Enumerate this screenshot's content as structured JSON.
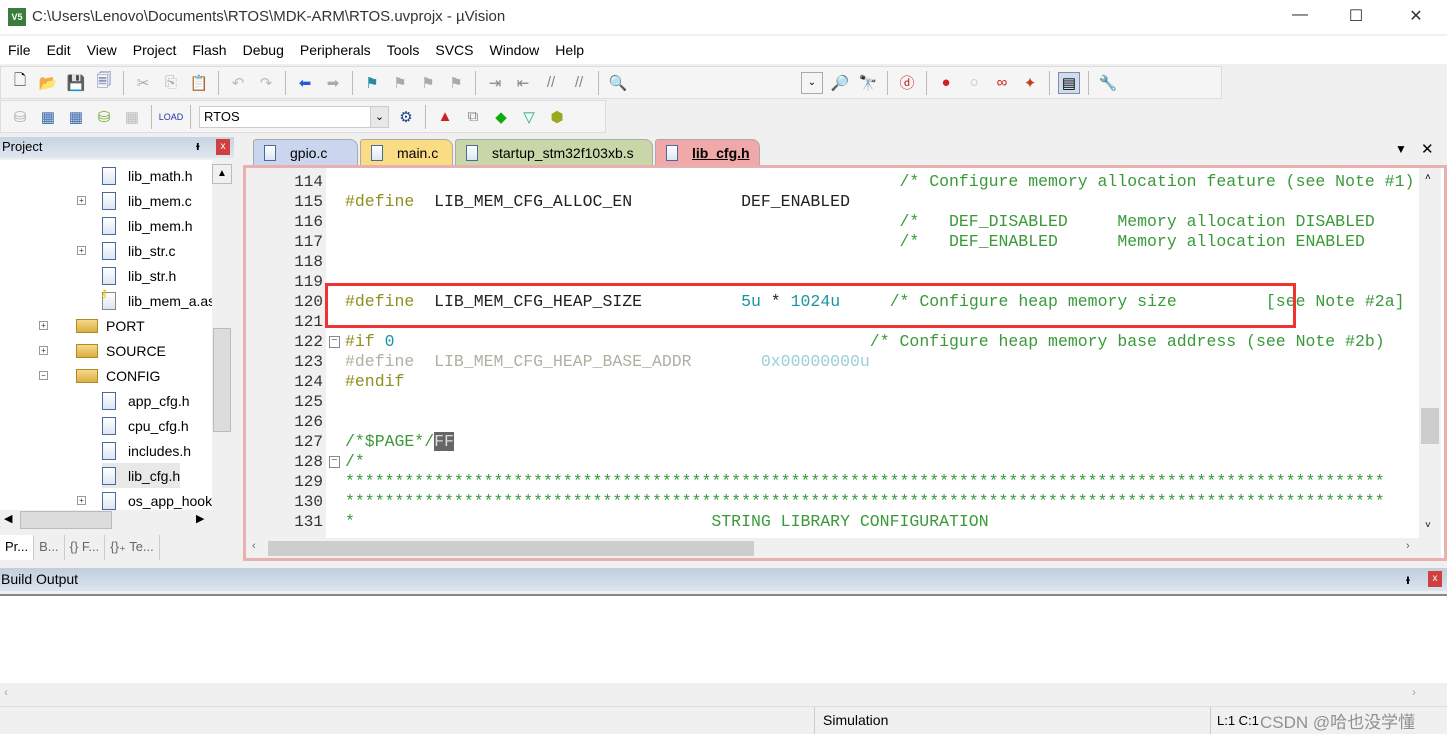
{
  "window": {
    "title": "C:\\Users\\Lenovo\\Documents\\RTOS\\MDK-ARM\\RTOS.uvprojx - µVision",
    "logo": "V5",
    "minimize": "—",
    "maximize": "☐",
    "close": "✕"
  },
  "menu": [
    "File",
    "Edit",
    "View",
    "Project",
    "Flash",
    "Debug",
    "Peripherals",
    "Tools",
    "SVCS",
    "Window",
    "Help"
  ],
  "toolbar": {
    "target": "RTOS"
  },
  "project_panel": {
    "title": "Project",
    "pin": "ᵼ",
    "close": "x",
    "items": [
      {
        "label": "lib_math.h",
        "kind": "file"
      },
      {
        "label": "lib_mem.c",
        "kind": "file",
        "expand": "+"
      },
      {
        "label": "lib_mem.h",
        "kind": "file"
      },
      {
        "label": "lib_str.c",
        "kind": "file",
        "expand": "+"
      },
      {
        "label": "lib_str.h",
        "kind": "file"
      },
      {
        "label": "lib_mem_a.as",
        "kind": "file-key"
      },
      {
        "label": "PORT",
        "kind": "folder",
        "expand": "+"
      },
      {
        "label": "SOURCE",
        "kind": "folder",
        "expand": "+"
      },
      {
        "label": "CONFIG",
        "kind": "folder",
        "expand": "−"
      },
      {
        "label": "app_cfg.h",
        "kind": "file"
      },
      {
        "label": "cpu_cfg.h",
        "kind": "file"
      },
      {
        "label": "includes.h",
        "kind": "file"
      },
      {
        "label": "lib_cfg.h",
        "kind": "file",
        "selected": true
      },
      {
        "label": "os_app_hook",
        "kind": "file",
        "expand": "+"
      }
    ],
    "tabs": [
      "Pr...",
      "B...",
      "{} F...",
      "{}₊ Te..."
    ]
  },
  "editor": {
    "tabs": [
      {
        "label": "gpio.c",
        "color": "#c9d6ee"
      },
      {
        "label": "main.c",
        "color": "#f9dc84"
      },
      {
        "label": "startup_stm32f103xb.s",
        "color": "#c9d6a8"
      },
      {
        "label": "lib_cfg.h",
        "color": "#f0a8a8",
        "active": true
      }
    ],
    "lines": [
      {
        "n": "114",
        "segs": [
          [
            "                                                        ",
            "id"
          ],
          [
            "/* Configure memory allocation feature (see Note #1)",
            "cm"
          ]
        ]
      },
      {
        "n": "115",
        "segs": [
          [
            "#define",
            "pp"
          ],
          [
            "  LIB_MEM_CFG_ALLOC_EN           DEF_ENABLED",
            "id"
          ]
        ]
      },
      {
        "n": "116",
        "segs": [
          [
            "                                                        /*   DEF_DISABLED     Memory allocation DISABLED",
            "cm"
          ]
        ]
      },
      {
        "n": "117",
        "segs": [
          [
            "                                                        /*   DEF_ENABLED      Memory allocation ENABLED",
            "cm"
          ]
        ]
      },
      {
        "n": "118",
        "segs": []
      },
      {
        "n": "119",
        "segs": []
      },
      {
        "n": "120",
        "segs": [
          [
            "#define",
            "pp"
          ],
          [
            "  LIB_MEM_CFG_HEAP_SIZE          ",
            "id"
          ],
          [
            "5u",
            "num"
          ],
          [
            " * ",
            "id"
          ],
          [
            "1024u",
            "num"
          ],
          [
            "     /* Configure heap memory size         [see Note #2a]",
            "cm"
          ]
        ]
      },
      {
        "n": "121",
        "segs": []
      },
      {
        "n": "122",
        "fold": "−",
        "segs": [
          [
            "#if",
            "pp"
          ],
          [
            " 0",
            "num"
          ],
          [
            "                                                /* Configure heap memory base address (see Note #2b)",
            "cm"
          ]
        ]
      },
      {
        "n": "123",
        "segs": [
          [
            "#define",
            "dim"
          ],
          [
            "  LIB_MEM_CFG_HEAP_BASE_ADDR       ",
            "dim"
          ],
          [
            "0x00000000u",
            "dimn"
          ]
        ]
      },
      {
        "n": "124",
        "segs": [
          [
            "#endif",
            "pp"
          ]
        ]
      },
      {
        "n": "125",
        "segs": []
      },
      {
        "n": "126",
        "segs": []
      },
      {
        "n": "127",
        "segs": [
          [
            "/*$PAGE*/",
            "cm"
          ],
          [
            "FF",
            "ff"
          ]
        ]
      },
      {
        "n": "128",
        "fold": "−",
        "segs": [
          [
            "/*",
            "cm"
          ]
        ]
      },
      {
        "n": "129",
        "segs": [
          [
            "*********************************************************************************************************",
            "cm"
          ]
        ]
      },
      {
        "n": "130",
        "segs": [
          [
            "*********************************************************************************************************",
            "cm"
          ]
        ]
      },
      {
        "n": "131",
        "segs": [
          [
            "*                                    STRING LIBRARY CONFIGURATION",
            "cm"
          ]
        ]
      }
    ]
  },
  "build_output": {
    "title": "Build Output",
    "pin": "ᵼ",
    "close": "x"
  },
  "status": {
    "mode": "Simulation",
    "position": "L:1 C:1",
    "watermark": "CSDN @哈也没学懂"
  }
}
